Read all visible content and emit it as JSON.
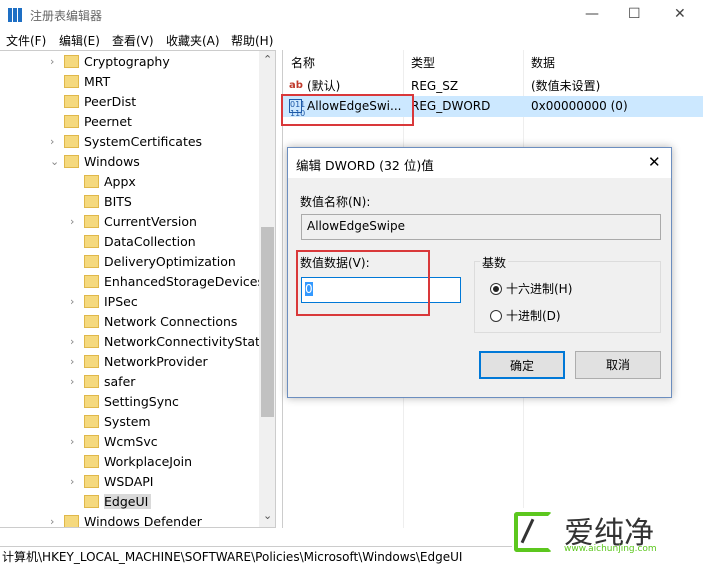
{
  "window": {
    "title": "注册表编辑器",
    "minimize": "—",
    "maximize": "☐",
    "close": "✕"
  },
  "menu": [
    "文件(F)",
    "编辑(E)",
    "查看(V)",
    "收藏夹(A)",
    "帮助(H)"
  ],
  "tree": [
    {
      "label": "Cryptography",
      "level": 0,
      "expand": ">"
    },
    {
      "label": "MRT",
      "level": 0,
      "expand": ""
    },
    {
      "label": "PeerDist",
      "level": 0,
      "expand": ""
    },
    {
      "label": "Peernet",
      "level": 0,
      "expand": ""
    },
    {
      "label": "SystemCertificates",
      "level": 0,
      "expand": ">"
    },
    {
      "label": "Windows",
      "level": 0,
      "expand": "v"
    },
    {
      "label": "Appx",
      "level": 1,
      "expand": ""
    },
    {
      "label": "BITS",
      "level": 1,
      "expand": ""
    },
    {
      "label": "CurrentVersion",
      "level": 1,
      "expand": ">"
    },
    {
      "label": "DataCollection",
      "level": 1,
      "expand": ""
    },
    {
      "label": "DeliveryOptimization",
      "level": 1,
      "expand": ""
    },
    {
      "label": "EnhancedStorageDevices",
      "level": 1,
      "expand": ""
    },
    {
      "label": "IPSec",
      "level": 1,
      "expand": ">"
    },
    {
      "label": "Network Connections",
      "level": 1,
      "expand": ""
    },
    {
      "label": "NetworkConnectivityStatus",
      "level": 1,
      "expand": ">"
    },
    {
      "label": "NetworkProvider",
      "level": 1,
      "expand": ">"
    },
    {
      "label": "safer",
      "level": 1,
      "expand": ">"
    },
    {
      "label": "SettingSync",
      "level": 1,
      "expand": ""
    },
    {
      "label": "System",
      "level": 1,
      "expand": ""
    },
    {
      "label": "WcmSvc",
      "level": 1,
      "expand": ">"
    },
    {
      "label": "WorkplaceJoin",
      "level": 1,
      "expand": ""
    },
    {
      "label": "WSDAPI",
      "level": 1,
      "expand": ">"
    },
    {
      "label": "EdgeUI",
      "level": 1,
      "expand": "",
      "selected": true
    },
    {
      "label": "Windows Defender",
      "level": 0,
      "expand": ">"
    }
  ],
  "list": {
    "headers": [
      "名称",
      "类型",
      "数据"
    ],
    "rows": [
      {
        "icon": "string-value-icon",
        "name": "(默认)",
        "type": "REG_SZ",
        "data": "(数值未设置)"
      },
      {
        "icon": "binary-value-icon",
        "name": "AllowEdgeSwi...",
        "type": "REG_DWORD",
        "data": "0x00000000 (0)",
        "selected": true
      }
    ]
  },
  "status": "计算机\\HKEY_LOCAL_MACHINE\\SOFTWARE\\Policies\\Microsoft\\Windows\\EdgeUI",
  "dialog": {
    "title": "编辑 DWORD (32 位)值",
    "name_label": "数值名称(N):",
    "name_value": "AllowEdgeSwipe",
    "data_label": "数值数据(V):",
    "data_value": "0",
    "base_label": "基数",
    "hex_label": "十六进制(H)",
    "dec_label": "十进制(D)",
    "base_selected": "hex",
    "ok": "确定",
    "cancel": "取消"
  },
  "watermark": {
    "text": "爱纯净",
    "url": "www.aichunjing.com",
    "color": "#5cc71e"
  },
  "colors": {
    "highlight": "#d9383a",
    "selection": "#cce8ff"
  }
}
